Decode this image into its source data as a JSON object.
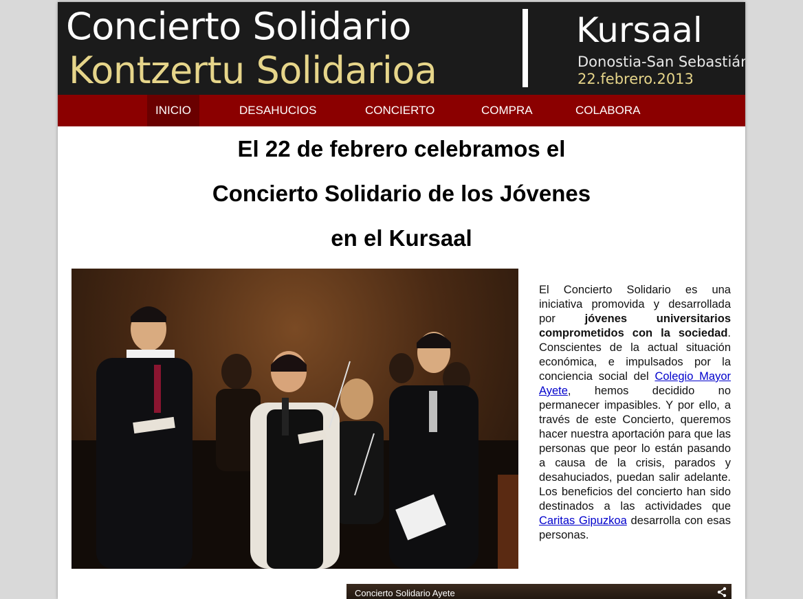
{
  "banner": {
    "title_es": "Concierto Solidario",
    "title_eu": "Kontzertu Solidarioa",
    "venue": "Kursaal",
    "city": "Donostia-San Sebastián",
    "date": "22.febrero.2013"
  },
  "nav": {
    "items": [
      {
        "label": "INICIO",
        "active": true
      },
      {
        "label": "DESAHUCIOS"
      },
      {
        "label": "CONCIERTO"
      },
      {
        "label": "COMPRA"
      },
      {
        "label": "COLABORA"
      }
    ]
  },
  "headline": {
    "line1": "El 22 de febrero celebramos el",
    "line2": "Concierto Solidario de los Jóvenes",
    "line3": "en el Kursaal"
  },
  "article": {
    "p1": "El Concierto Solidario es una iniciativa promovida y desarrollada por ",
    "bold1": "jóvenes universitarios comprometidos con la sociedad",
    "p2": ". Conscientes de la actual situación económica, e impulsados por la conciencia social del ",
    "link1": "Colegio Mayor Ayete",
    "p3": ", hemos decidido no permanecer impasibles. Y por ello, a través de este Concierto, queremos hacer nuestra aportación para que las personas que peor lo están pasando a causa de la crisis, parados y desahuciados, puedan salir adelante. Los beneficios del concierto han sido destinados a las actividades que ",
    "link2": "Caritas Gipuzkoa",
    "p4": " desarrolla con esas personas."
  },
  "video": {
    "title": "Concierto Solidario Ayete",
    "share_icon": "share-icon"
  },
  "colors": {
    "nav_bg": "#8b0000",
    "nav_active": "#6a0000",
    "banner_bg": "#1b1b1b",
    "accent_gold": "#e6d58a",
    "link": "#0000cc"
  }
}
